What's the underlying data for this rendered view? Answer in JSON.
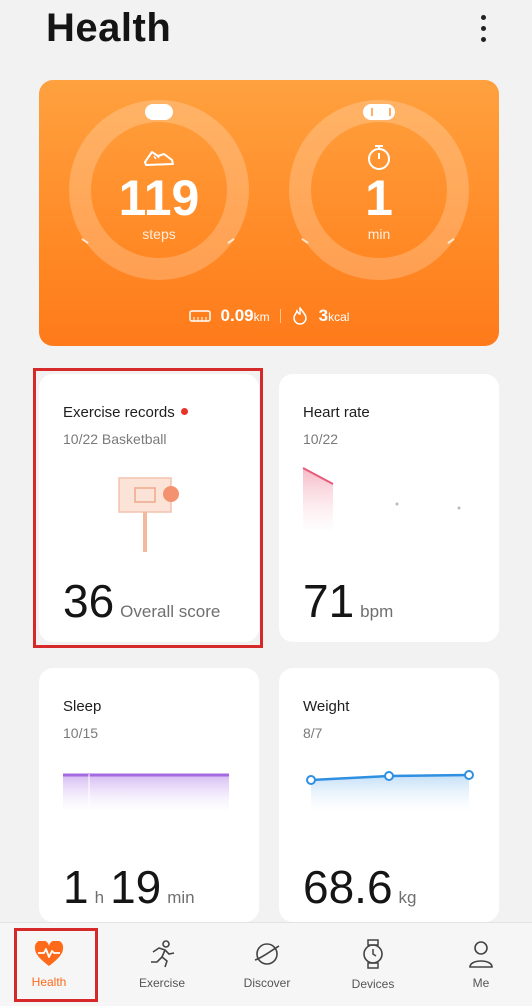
{
  "header": {
    "title": "Health"
  },
  "activity": {
    "steps": {
      "value": "119",
      "unit": "steps"
    },
    "time": {
      "value": "1",
      "unit": "min"
    },
    "distance": {
      "value": "0.09",
      "unit": "km"
    },
    "calories": {
      "value": "3",
      "unit": "kcal"
    }
  },
  "cards": {
    "exercise": {
      "title": "Exercise records",
      "subtitle": "10/22 Basketball",
      "value": "36",
      "unit": "Overall score"
    },
    "heart_rate": {
      "title": "Heart rate",
      "subtitle": "10/22",
      "value": "71",
      "unit": "bpm"
    },
    "sleep": {
      "title": "Sleep",
      "subtitle": "10/15",
      "hours": "1",
      "hours_unit": "h",
      "minutes": "19",
      "minutes_unit": "min"
    },
    "weight": {
      "title": "Weight",
      "subtitle": "8/7",
      "value": "68.6",
      "unit": "kg"
    }
  },
  "nav": {
    "items": [
      {
        "label": "Health",
        "icon": "heart-pulse-icon"
      },
      {
        "label": "Exercise",
        "icon": "running-icon"
      },
      {
        "label": "Discover",
        "icon": "planet-icon"
      },
      {
        "label": "Devices",
        "icon": "watch-icon"
      },
      {
        "label": "Me",
        "icon": "person-icon"
      }
    ]
  },
  "colors": {
    "accent": "#ff8a26",
    "highlight": "#d62a2a",
    "sleep": "#a56ae0",
    "weight": "#2f8fe0",
    "heart": "#e85a7a"
  }
}
